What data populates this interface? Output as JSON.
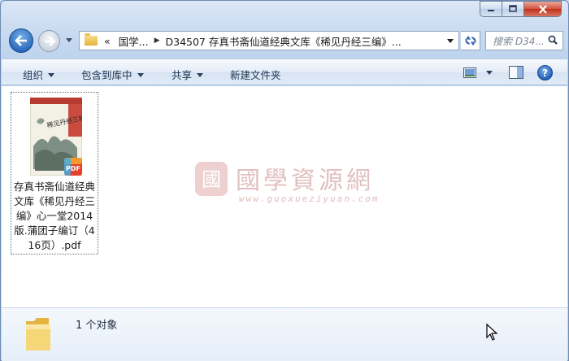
{
  "address": {
    "overflow": "«",
    "crumb1": "国学...",
    "crumb2": "D34507 存真书斋仙道经典文库《稀见丹经三编》..."
  },
  "search": {
    "placeholder": "搜索 D34..."
  },
  "toolbar": {
    "organize": "组织",
    "include_library": "包含到库中",
    "share": "共享",
    "new_folder": "新建文件夹"
  },
  "file": {
    "name": "存真书斋仙道经典文库《稀见丹经三编》心一堂2014版.蒲团子编订（416页）.pdf",
    "badge": "PDF",
    "cover_title": "稀见丹经三编"
  },
  "watermark": {
    "text": "國學資源網",
    "url": "www.guoxueziyuan.com"
  },
  "details": {
    "count": "1 个对象"
  },
  "colors": {
    "accent": "#2c6bbf",
    "pdf_badge": "#e6402c"
  }
}
